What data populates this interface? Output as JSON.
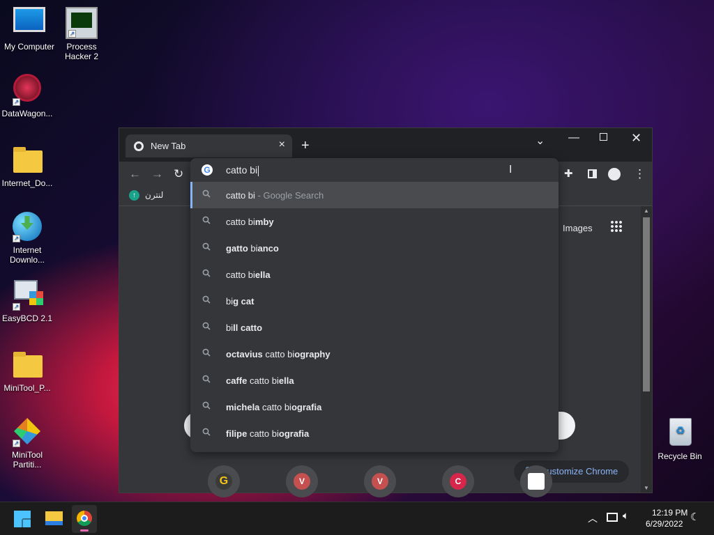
{
  "desktop": {
    "icons": [
      {
        "label": "My Computer"
      },
      {
        "label": "Process Hacker 2"
      },
      {
        "label": "DataWagon..."
      },
      {
        "label": "Internet_Do..."
      },
      {
        "label": "Internet Downlo..."
      },
      {
        "label": "EasyBCD 2.1"
      },
      {
        "label": "MiniTool_P..."
      },
      {
        "label": "MiniTool Partiti..."
      },
      {
        "label": "Recycle Bin"
      }
    ]
  },
  "browser": {
    "tab_title": "New Tab",
    "bookmark": "لنترن",
    "omnibox_text": "catto bi",
    "suggestions": [
      {
        "pre": "catto bi",
        "post": "",
        "suffix": " - Google Search"
      },
      {
        "pre": "catto bi",
        "post": "mby"
      },
      {
        "b1": "gatto",
        "mid": " bi",
        "post": "anco"
      },
      {
        "pre": "catto bi",
        "post": "ella"
      },
      {
        "pre": "bi",
        "post": "g cat"
      },
      {
        "pre": "bi",
        "post": "ll catto"
      },
      {
        "b1": "octavius",
        "mid": " catto bi",
        "post": "ography"
      },
      {
        "b1": "caffe",
        "mid": " catto bi",
        "post": "ella"
      },
      {
        "b1": "michela",
        "mid": " catto bi",
        "post": "ografia"
      },
      {
        "b1": "filipe",
        "mid": " catto bi",
        "post": "ografia"
      }
    ],
    "images_link": "Images",
    "customize_label": "Customize Chrome",
    "shortcuts": [
      {
        "letter": "G",
        "color": "#3a3a3a",
        "fg": "#f5c518"
      },
      {
        "letter": "V",
        "color": "#c45050",
        "fg": "#fff"
      },
      {
        "letter": "V",
        "color": "#c45050",
        "fg": "#fff"
      },
      {
        "letter": "C",
        "color": "#d6264a",
        "fg": "#fff"
      }
    ]
  },
  "taskbar": {
    "time": "12:19 PM",
    "date": "6/29/2022"
  }
}
